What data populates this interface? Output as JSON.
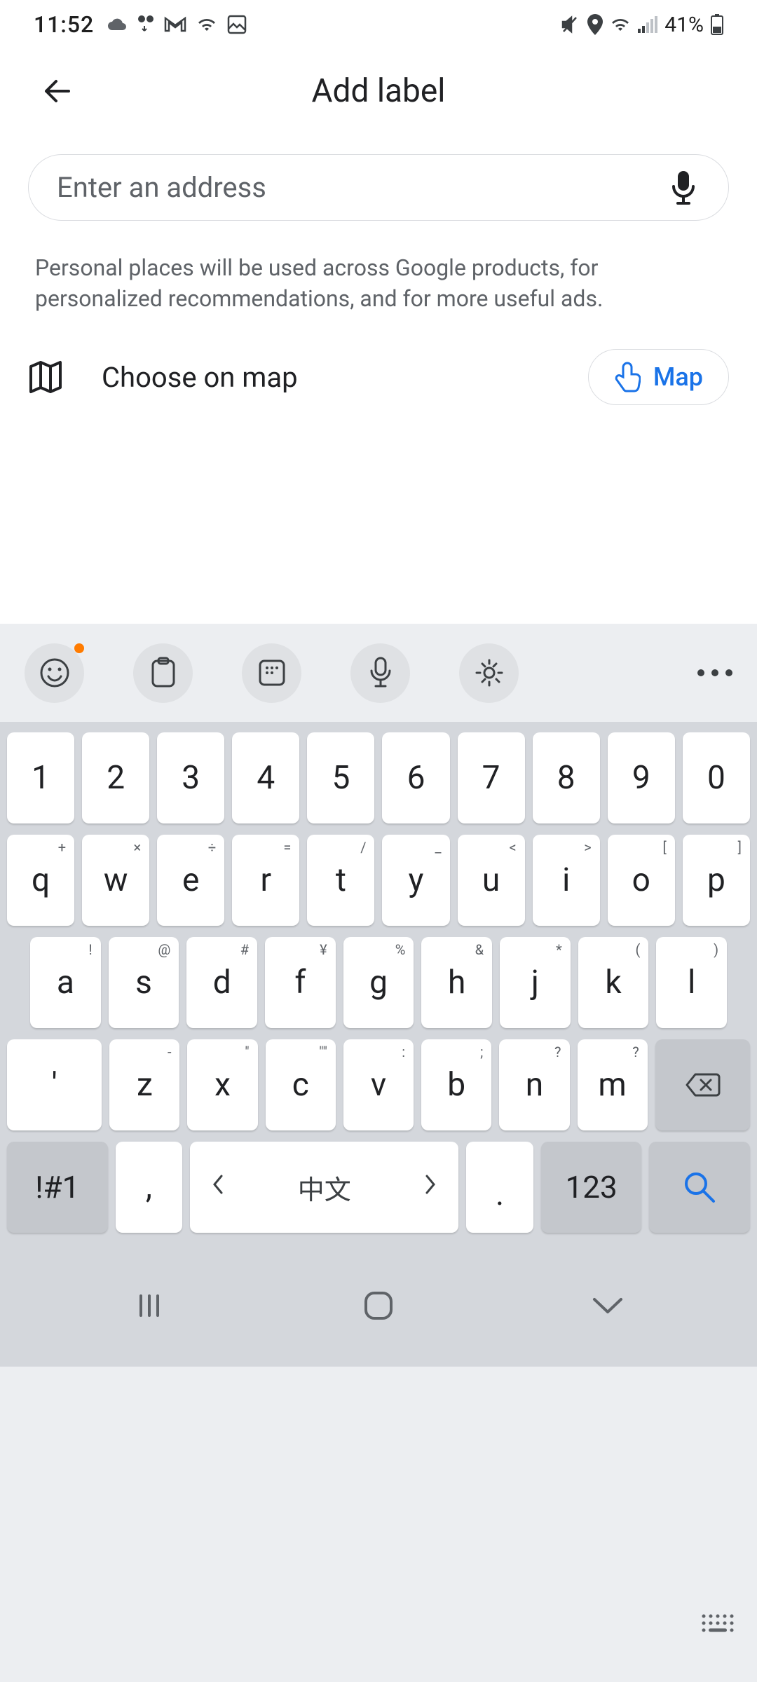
{
  "status": {
    "time": "11:52",
    "battery": "41%"
  },
  "header": {
    "title": "Add label"
  },
  "search": {
    "placeholder": "Enter an address"
  },
  "info": "Personal places will be used across Google products, for personalized recommendations, and for more useful ads.",
  "map": {
    "choose_label": "Choose on map",
    "pill_label": "Map"
  },
  "keyboard": {
    "row1": [
      "1",
      "2",
      "3",
      "4",
      "5",
      "6",
      "7",
      "8",
      "9",
      "0"
    ],
    "row2": {
      "keys": [
        "q",
        "w",
        "e",
        "r",
        "t",
        "y",
        "u",
        "i",
        "o",
        "p"
      ],
      "hints": [
        "+",
        "×",
        "÷",
        "=",
        "/",
        "_",
        "<",
        ">",
        "[",
        "]"
      ]
    },
    "row3": {
      "keys": [
        "a",
        "s",
        "d",
        "f",
        "g",
        "h",
        "j",
        "k",
        "l"
      ],
      "hints": [
        "!",
        "@",
        "#",
        "¥",
        "%",
        "&",
        "*",
        "(",
        ")"
      ]
    },
    "row4": {
      "apostrophe": "'",
      "keys": [
        "z",
        "x",
        "c",
        "v",
        "b",
        "n",
        "m"
      ],
      "hints": [
        "-",
        "\"",
        "\"\"",
        ":",
        ";",
        "?",
        "?"
      ]
    },
    "bottom": {
      "sym": "!#1",
      "comma": ",",
      "lang": "中文",
      "period": ".",
      "num": "123"
    }
  }
}
